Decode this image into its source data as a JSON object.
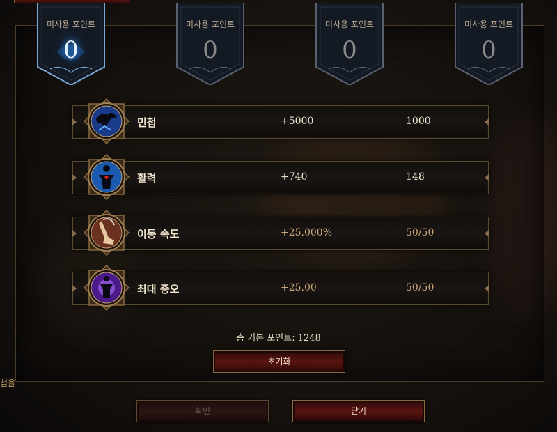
{
  "banners": [
    {
      "label": "미사용 포인트",
      "value": "0",
      "active": true
    },
    {
      "label": "미사용 포인트",
      "value": "0",
      "active": false
    },
    {
      "label": "미사용 포인트",
      "value": "0",
      "active": false
    },
    {
      "label": "미사용 포인트",
      "value": "0",
      "active": false
    }
  ],
  "stats": [
    {
      "name": "민첩",
      "bonus": "+5000",
      "value": "1000",
      "icon": "agility-icon",
      "maxed": false
    },
    {
      "name": "활력",
      "bonus": "+740",
      "value": "148",
      "icon": "vitality-icon",
      "maxed": false
    },
    {
      "name": "이동 속도",
      "bonus": "+25.000%",
      "value": "50/50",
      "icon": "movement-speed-icon",
      "maxed": true
    },
    {
      "name": "최대 증오",
      "bonus": "+25.00",
      "value": "50/50",
      "icon": "max-hatred-icon",
      "maxed": true
    }
  ],
  "total": {
    "label": "총 기본 포인트:",
    "value": "1248"
  },
  "buttons": {
    "reset": "초기화",
    "confirm": "확인",
    "close": "닫기"
  },
  "side_text": "첨을",
  "colors": {
    "accent_gold": "#c9a77a",
    "button_red": "#5a1410",
    "glow_blue": "#3aa0ff"
  }
}
